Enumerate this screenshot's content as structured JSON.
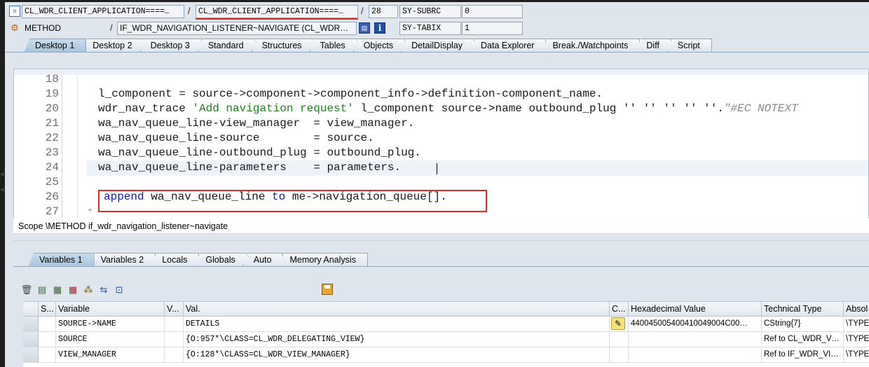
{
  "header": {
    "row1": {
      "program": "CL_WDR_CLIENT_APPLICATION====…",
      "include": "CL_WDR_CLIENT_APPLICATION====…",
      "line": "28",
      "field_name": "SY-SUBRC",
      "field_value": "0"
    },
    "row2": {
      "event_type": "METHOD",
      "event_name": "IF_WDR_NAVIGATION_LISTENER~NAVIGATE (CL_WDR…",
      "field_name": "SY-TABIX",
      "field_value": "1"
    },
    "separator": "/"
  },
  "main_tabs": [
    "Desktop 1",
    "Desktop 2",
    "Desktop 3",
    "Standard",
    "Structures",
    "Tables",
    "Objects",
    "DetailDisplay",
    "Data Explorer",
    "Break./Watchpoints",
    "Diff",
    "Script"
  ],
  "editor": {
    "line_numbers": [
      "18",
      "19",
      "20",
      "21",
      "22",
      "23",
      "24",
      "25",
      "26",
      "27"
    ],
    "lines": {
      "l19": "l_component = source->component->component_info->definition-component_name.",
      "l20_a": "wdr_nav_trace ",
      "l20_str": "'Add navigation request'",
      "l20_b": " l_component source->name outbound_plug '' '' '' '' ''.",
      "l20_cmt": "\"#EC NOTEXT",
      "l21": "wa_nav_queue_line-view_manager  = view_manager.",
      "l22": "wa_nav_queue_line-source        = source.",
      "l23": "wa_nav_queue_line-outbound_plug = outbound_plug.",
      "l24": "wa_nav_queue_line-parameters    = parameters.",
      "l26_kw1": "append",
      "l26_a": " wa_nav_queue_line ",
      "l26_kw2": "to",
      "l26_b": " me->navigation_queue[].",
      "l27_star": "*"
    }
  },
  "scope": "Scope \\METHOD if_wdr_navigation_listener~navigate",
  "var_tabs": [
    "Variables 1",
    "Variables 2",
    "Locals",
    "Globals",
    "Auto",
    "Memory Analysis"
  ],
  "toolbar_icons": [
    "delete-icon",
    "insert-row-icon",
    "import-icon",
    "export-icon",
    "tree-icon",
    "navigate-icon",
    "settings-icon"
  ],
  "table": {
    "columns": [
      "S...",
      "Variable",
      "V...",
      "Val.",
      "C...",
      "Hexadecimal Value",
      "Technical Type",
      "Absol"
    ],
    "rows": [
      {
        "variable": "SOURCE->NAME",
        "value": "DETAILS",
        "hex": "440045005400410049004C00…",
        "type": "CString{7}",
        "abs": "\\TYPE"
      },
      {
        "variable": "SOURCE",
        "value": "{O:957*\\CLASS=CL_WDR_DELEGATING_VIEW}",
        "hex": "",
        "type": "Ref to CL_WDR_V…",
        "abs": "\\TYPE"
      },
      {
        "variable": "VIEW_MANAGER",
        "value": "{O:128*\\CLASS=CL_WDR_VIEW_MANAGER}",
        "hex": "",
        "type": "Ref to IF_WDR_VI…",
        "abs": "\\TYPE"
      }
    ]
  },
  "colors": {
    "accent_red": "#d42b2b",
    "keyword_blue": "#1515cc",
    "string_green": "#208020",
    "active_tab": "#b8d1e8"
  }
}
